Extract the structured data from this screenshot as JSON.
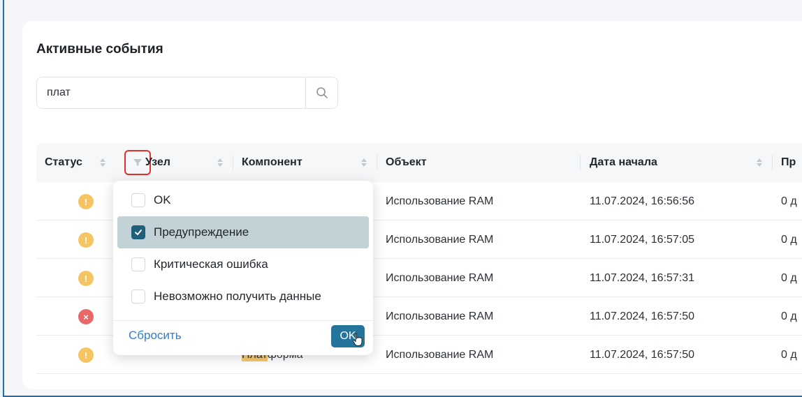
{
  "page": {
    "title": "Активные события",
    "search": {
      "value": "плат"
    }
  },
  "table": {
    "columns": [
      "Статус",
      "Узел",
      "Компонент",
      "Объект",
      "Дата начала",
      "Пр"
    ],
    "rows": [
      {
        "status": "warning",
        "object": "Использование RAM",
        "start": "11.07.2024, 16:56:56",
        "duration": "0 д"
      },
      {
        "status": "warning",
        "object": "Использование RAM",
        "start": "11.07.2024, 16:57:05",
        "duration": "0 д"
      },
      {
        "status": "warning",
        "object": "Использование RAM",
        "start": "11.07.2024, 16:57:31",
        "duration": "0 д"
      },
      {
        "status": "critical",
        "object": "Использование RAM",
        "start": "11.07.2024, 16:57:50",
        "duration": "0 д"
      },
      {
        "status": "warning",
        "object": "Использование RAM",
        "start": "11.07.2024, 16:57:50",
        "duration": "0 д",
        "component_match": "Плат",
        "component_rest": "форма"
      }
    ]
  },
  "status_filter": {
    "options": [
      {
        "label": "OK",
        "checked": false
      },
      {
        "label": "Предупреждение",
        "checked": true
      },
      {
        "label": "Критическая ошибка",
        "checked": false
      },
      {
        "label": "Невозможно получить данные",
        "checked": false
      }
    ],
    "reset_label": "Сбросить",
    "ok_label": "OK"
  },
  "colors": {
    "warning": "#f5c563",
    "critical": "#e8686a",
    "accent": "#25749b",
    "link": "#2f7fcf",
    "filter_highlight": "#e0312b",
    "search_match": "#f8c868"
  },
  "icons": {
    "search": "search-icon",
    "filter": "filter-icon",
    "sort": "sort-icon",
    "warning": "warning-icon",
    "critical": "error-icon",
    "check": "check-icon",
    "cursor": "hand-cursor-icon"
  }
}
